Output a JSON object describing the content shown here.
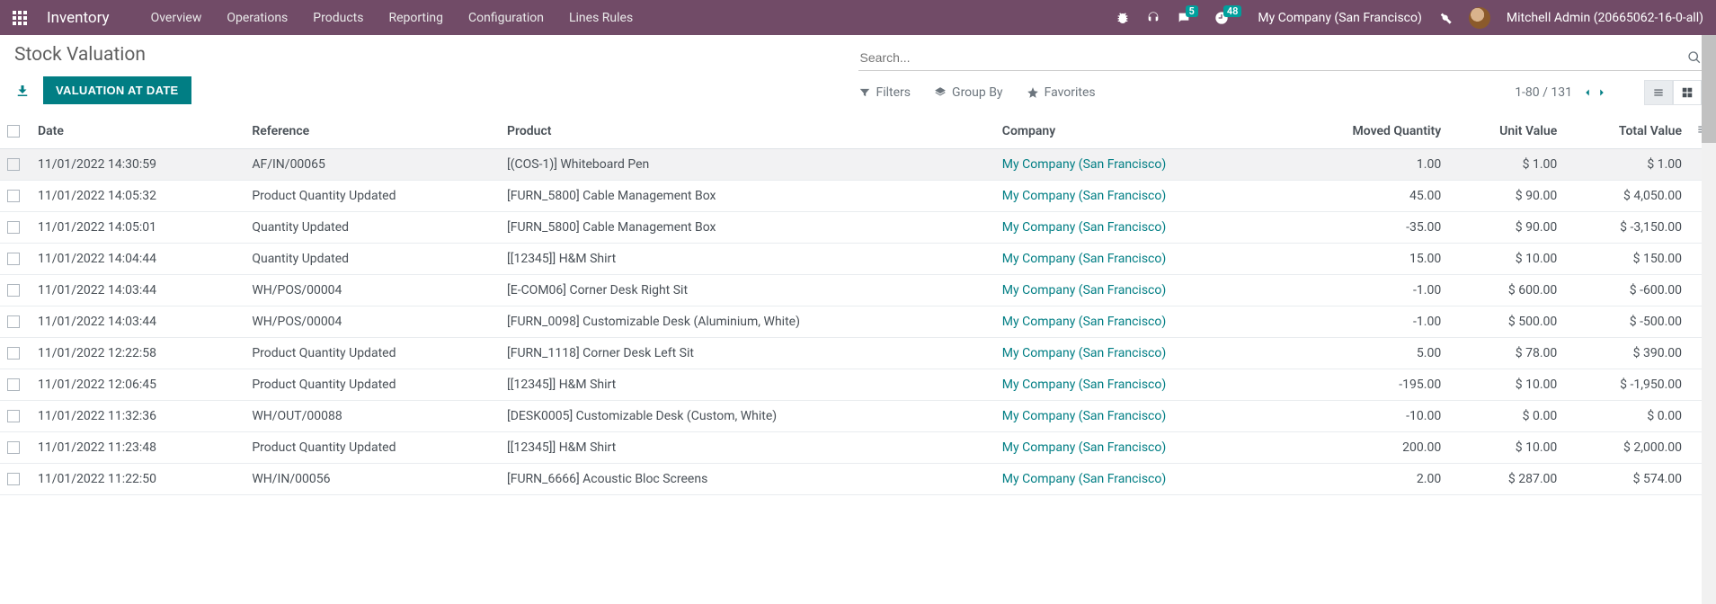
{
  "topbar": {
    "app_name": "Inventory",
    "menu": [
      "Overview",
      "Operations",
      "Products",
      "Reporting",
      "Configuration",
      "Lines Rules"
    ],
    "chat_badge": "5",
    "clock_badge": "48",
    "company": "My Company (San Francisco)",
    "user": "Mitchell Admin (20665062-16-0-all)"
  },
  "page_title": "Stock Valuation",
  "actions": {
    "valuation_button": "VALUATION AT DATE"
  },
  "search": {
    "placeholder": "Search..."
  },
  "toolbar": {
    "filters": "Filters",
    "group_by": "Group By",
    "favorites": "Favorites",
    "pager": "1-80 / 131"
  },
  "columns": {
    "date": "Date",
    "reference": "Reference",
    "product": "Product",
    "company": "Company",
    "moved_qty": "Moved Quantity",
    "unit_value": "Unit Value",
    "total_value": "Total Value"
  },
  "rows": [
    {
      "date": "11/01/2022 14:30:59",
      "reference": "AF/IN/00065",
      "product": "[(COS-1)] Whiteboard Pen",
      "company": "My Company (San Francisco)",
      "moved_qty": "1.00",
      "unit_value": "$ 1.00",
      "total_value": "$ 1.00"
    },
    {
      "date": "11/01/2022 14:05:32",
      "reference": "Product Quantity Updated",
      "product": "[FURN_5800] Cable Management Box",
      "company": "My Company (San Francisco)",
      "moved_qty": "45.00",
      "unit_value": "$ 90.00",
      "total_value": "$ 4,050.00"
    },
    {
      "date": "11/01/2022 14:05:01",
      "reference": "Quantity Updated",
      "product": "[FURN_5800] Cable Management Box",
      "company": "My Company (San Francisco)",
      "moved_qty": "-35.00",
      "unit_value": "$ 90.00",
      "total_value": "$ -3,150.00"
    },
    {
      "date": "11/01/2022 14:04:44",
      "reference": "Quantity Updated",
      "product": "[[12345]] H&M Shirt",
      "company": "My Company (San Francisco)",
      "moved_qty": "15.00",
      "unit_value": "$ 10.00",
      "total_value": "$ 150.00"
    },
    {
      "date": "11/01/2022 14:03:44",
      "reference": "WH/POS/00004",
      "product": "[E-COM06] Corner Desk Right Sit",
      "company": "My Company (San Francisco)",
      "moved_qty": "-1.00",
      "unit_value": "$ 600.00",
      "total_value": "$ -600.00"
    },
    {
      "date": "11/01/2022 14:03:44",
      "reference": "WH/POS/00004",
      "product": "[FURN_0098] Customizable Desk (Aluminium, White)",
      "company": "My Company (San Francisco)",
      "moved_qty": "-1.00",
      "unit_value": "$ 500.00",
      "total_value": "$ -500.00"
    },
    {
      "date": "11/01/2022 12:22:58",
      "reference": "Product Quantity Updated",
      "product": "[FURN_1118] Corner Desk Left Sit",
      "company": "My Company (San Francisco)",
      "moved_qty": "5.00",
      "unit_value": "$ 78.00",
      "total_value": "$ 390.00"
    },
    {
      "date": "11/01/2022 12:06:45",
      "reference": "Product Quantity Updated",
      "product": "[[12345]] H&M Shirt",
      "company": "My Company (San Francisco)",
      "moved_qty": "-195.00",
      "unit_value": "$ 10.00",
      "total_value": "$ -1,950.00"
    },
    {
      "date": "11/01/2022 11:32:36",
      "reference": "WH/OUT/00088",
      "product": "[DESK0005] Customizable Desk (Custom, White)",
      "company": "My Company (San Francisco)",
      "moved_qty": "-10.00",
      "unit_value": "$ 0.00",
      "total_value": "$ 0.00"
    },
    {
      "date": "11/01/2022 11:23:48",
      "reference": "Product Quantity Updated",
      "product": "[[12345]] H&M Shirt",
      "company": "My Company (San Francisco)",
      "moved_qty": "200.00",
      "unit_value": "$ 10.00",
      "total_value": "$ 2,000.00"
    },
    {
      "date": "11/01/2022 11:22:50",
      "reference": "WH/IN/00056",
      "product": "[FURN_6666] Acoustic Bloc Screens",
      "company": "My Company (San Francisco)",
      "moved_qty": "2.00",
      "unit_value": "$ 287.00",
      "total_value": "$ 574.00"
    }
  ]
}
